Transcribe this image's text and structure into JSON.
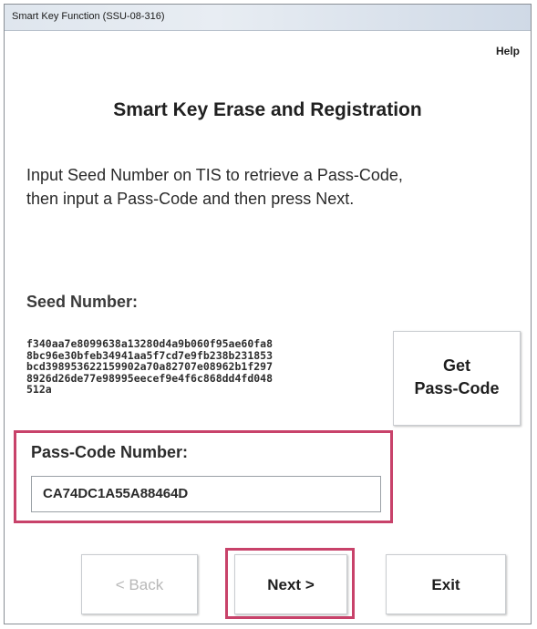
{
  "window": {
    "title": "Smart Key Function (SSU-08-316)"
  },
  "help_label": "Help",
  "heading": "Smart Key Erase and Registration",
  "instructions": {
    "line1": "Input Seed Number on TIS to retrieve a Pass-Code,",
    "line2": "then input a Pass-Code and then press Next."
  },
  "seed": {
    "label": "Seed Number:",
    "value": "f340aa7e8099638a13280d4a9b060f95ae60fa8\n8bc96e30bfeb34941aa5f7cd7e9fb238b231853\nbcd398953622159902a70a82707e08962b1f297\n8926d26de77e98995eecef9e4f6c868dd4fd048\n512a"
  },
  "get_passcode_button": {
    "line1": "Get",
    "line2": "Pass-Code"
  },
  "passcode": {
    "label": "Pass-Code Number:",
    "value": "CA74DC1A55A88464D"
  },
  "buttons": {
    "back": "< Back",
    "next": "Next >",
    "exit": "Exit"
  },
  "colors": {
    "highlight": "#c8426a",
    "disabled_text": "#b8b8b8"
  }
}
